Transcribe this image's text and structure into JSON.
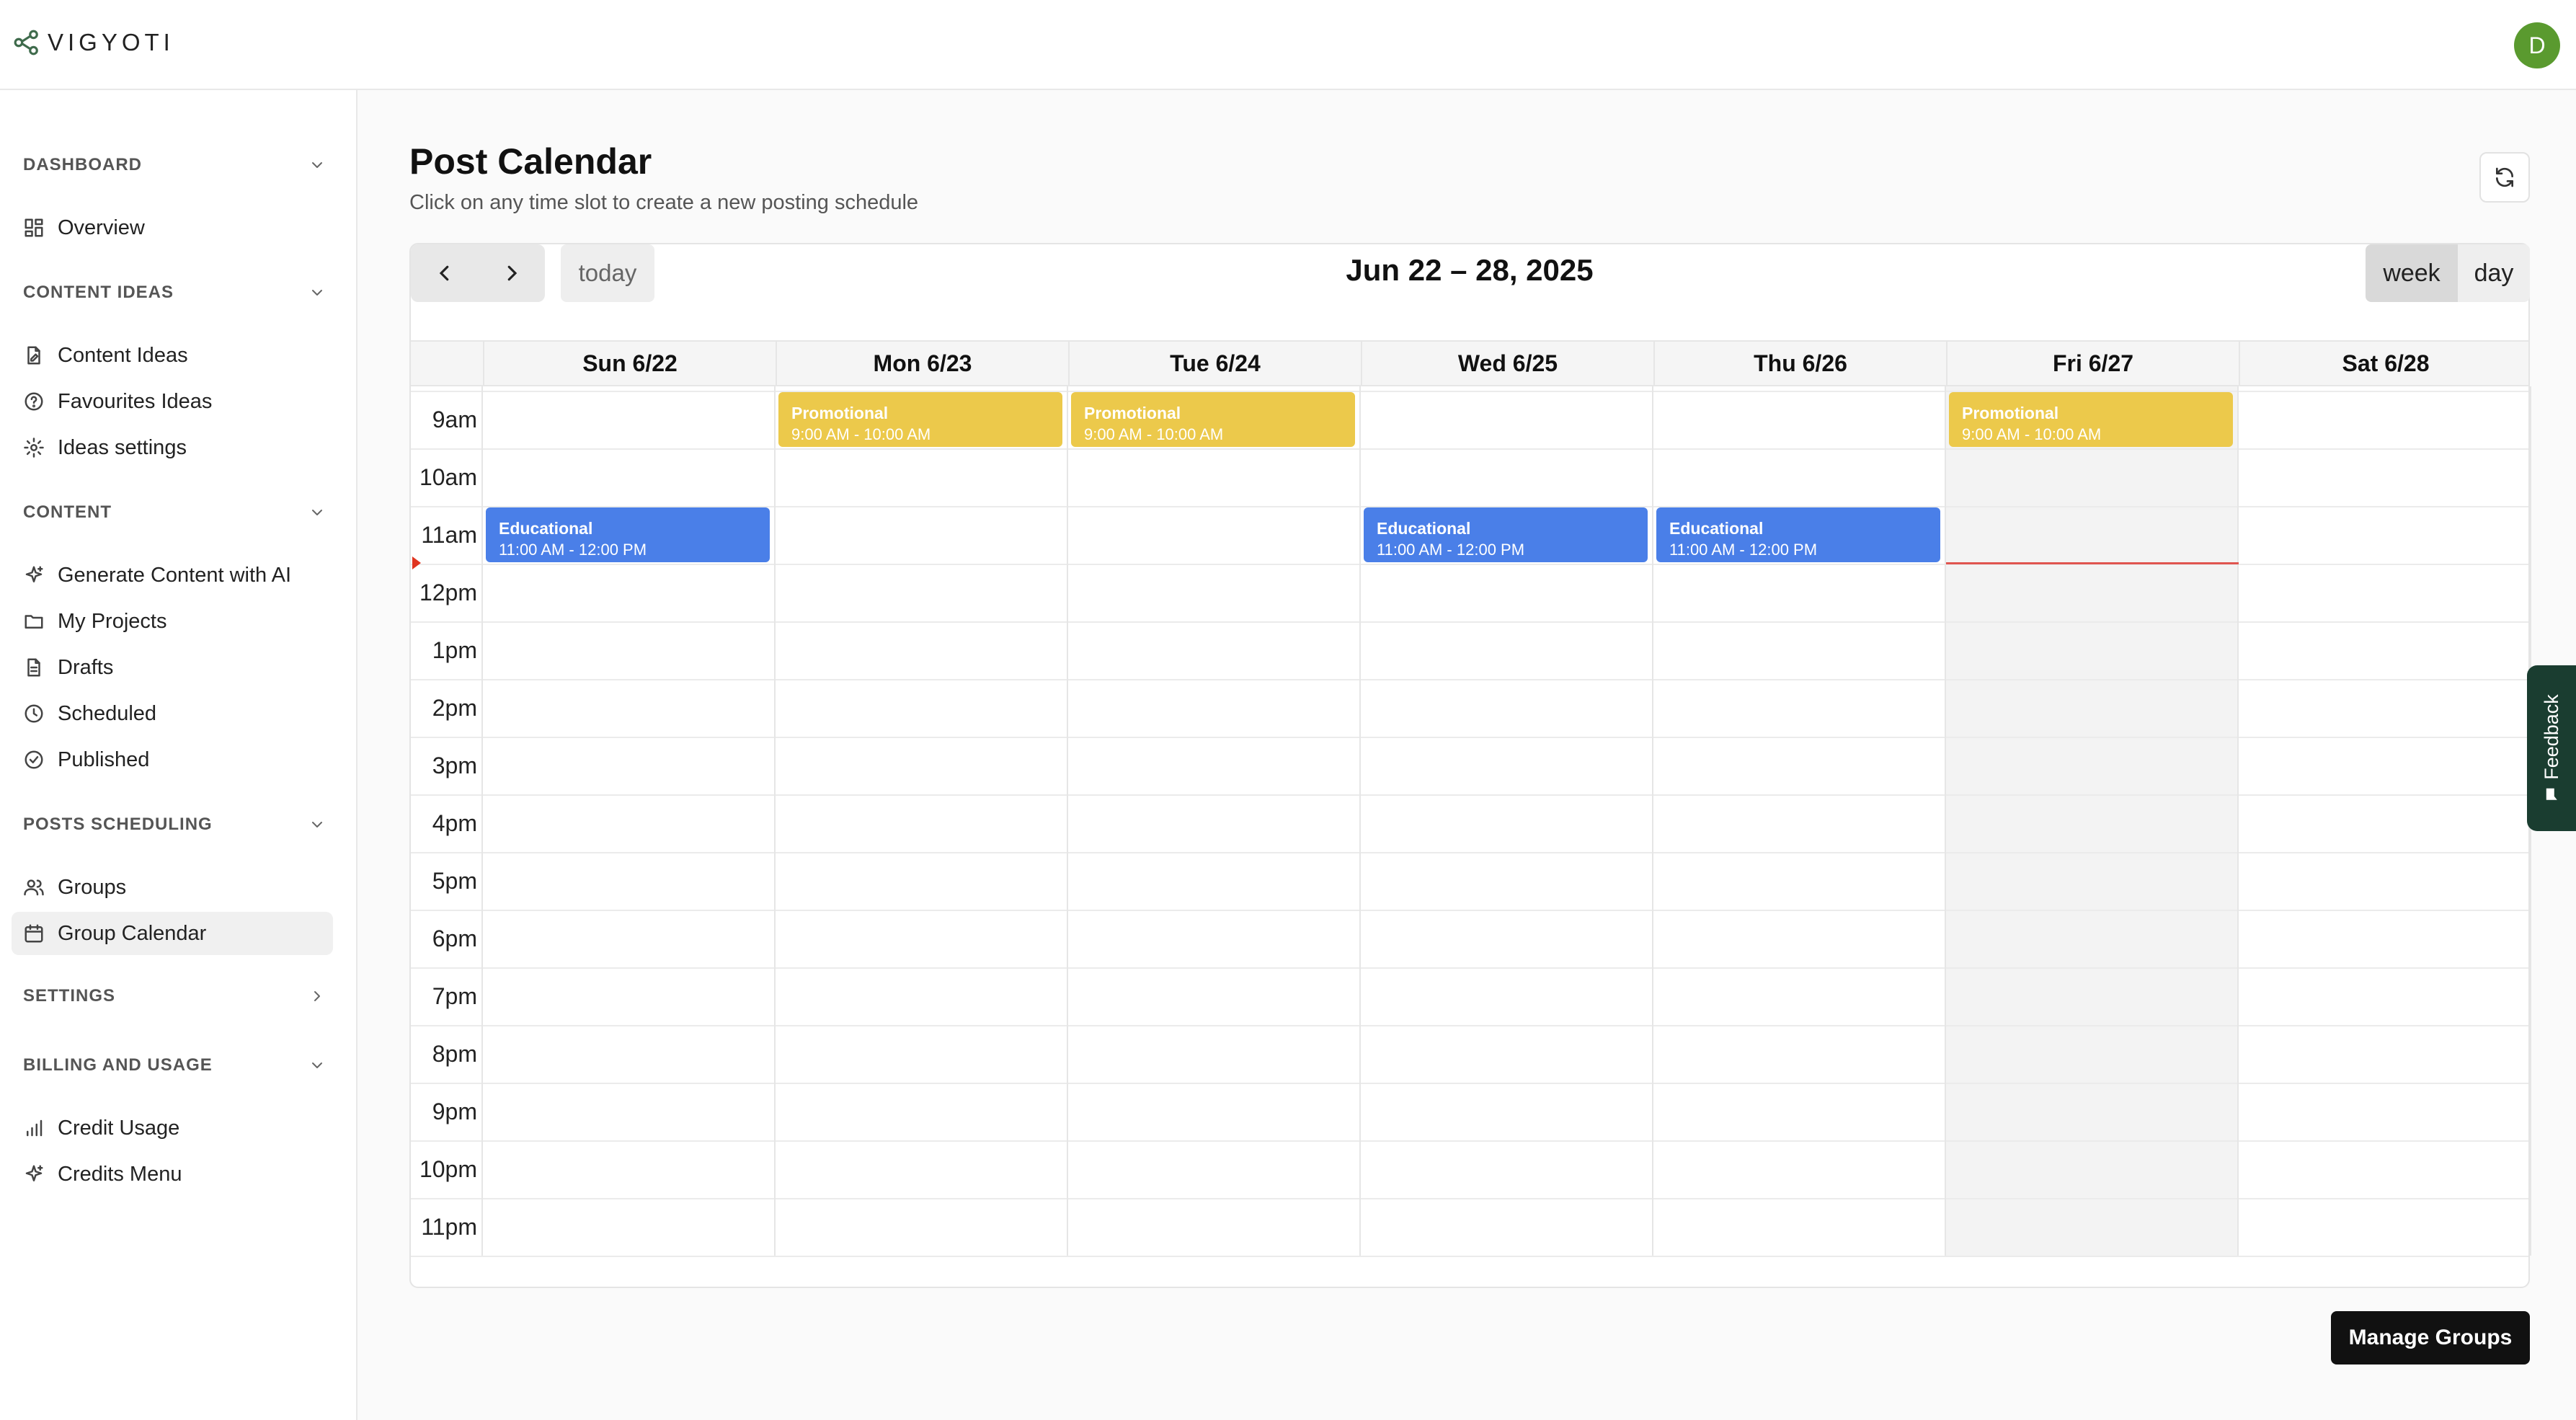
{
  "app": {
    "brand": "VIGYOTI",
    "avatar_initial": "D",
    "avatar_color": "#5a9a2f"
  },
  "sidebar": {
    "sections": [
      {
        "title": "DASHBOARD",
        "chevron": "chevron-down-icon",
        "items": [
          {
            "label": "Overview",
            "icon": "grid-icon"
          }
        ]
      },
      {
        "title": "CONTENT IDEAS",
        "chevron": "chevron-down-icon",
        "items": [
          {
            "label": "Content Ideas",
            "icon": "file-pen-icon"
          },
          {
            "label": "Favourites Ideas",
            "icon": "help-circle-icon"
          },
          {
            "label": "Ideas settings",
            "icon": "gear-icon"
          }
        ]
      },
      {
        "title": "CONTENT",
        "chevron": "chevron-down-icon",
        "items": [
          {
            "label": "Generate Content with AI",
            "icon": "sparkle-icon"
          },
          {
            "label": "My Projects",
            "icon": "folder-icon"
          },
          {
            "label": "Drafts",
            "icon": "document-icon"
          },
          {
            "label": "Scheduled",
            "icon": "clock-icon"
          },
          {
            "label": "Published",
            "icon": "check-circle-icon"
          }
        ]
      },
      {
        "title": "POSTS SCHEDULING",
        "chevron": "chevron-down-icon",
        "items": [
          {
            "label": "Groups",
            "icon": "users-icon"
          },
          {
            "label": "Group Calendar",
            "icon": "calendar-icon",
            "active": true
          }
        ]
      },
      {
        "title": "SETTINGS",
        "chevron": "chevron-right-icon",
        "items": []
      },
      {
        "title": "BILLING AND USAGE",
        "chevron": "chevron-down-icon",
        "items": [
          {
            "label": "Credit Usage",
            "icon": "bar-chart-icon"
          },
          {
            "label": "Credits Menu",
            "icon": "sparkle-icon"
          }
        ]
      }
    ]
  },
  "page": {
    "title": "Post Calendar",
    "subtitle": "Click on any time slot to create a new posting schedule"
  },
  "calendar": {
    "today_label": "today",
    "range_title": "Jun 22 – 28, 2025",
    "views": {
      "week": "week",
      "day": "day",
      "active": "week"
    },
    "days": [
      "Sun 6/22",
      "Mon 6/23",
      "Tue 6/24",
      "Wed 6/25",
      "Thu 6/26",
      "Fri 6/27",
      "Sat 6/28"
    ],
    "today_day": "Fri 6/27",
    "time_slots": [
      "9am",
      "10am",
      "11am",
      "12pm",
      "1pm",
      "2pm",
      "3pm",
      "4pm",
      "5pm",
      "6pm",
      "7pm",
      "8pm",
      "9pm",
      "10pm",
      "11pm"
    ],
    "events": [
      {
        "day": "Mon 6/23",
        "title": "Promotional",
        "time": "9:00 AM - 10:00 AM",
        "type": "promo",
        "start_slot": "9am"
      },
      {
        "day": "Tue 6/24",
        "title": "Promotional",
        "time": "9:00 AM - 10:00 AM",
        "type": "promo",
        "start_slot": "9am"
      },
      {
        "day": "Fri 6/27",
        "title": "Promotional",
        "time": "9:00 AM - 10:00 AM",
        "type": "promo",
        "start_slot": "9am"
      },
      {
        "day": "Sun 6/22",
        "title": "Educational",
        "time": "11:00 AM - 12:00 PM",
        "type": "edu",
        "start_slot": "11am"
      },
      {
        "day": "Wed 6/25",
        "title": "Educational",
        "time": "11:00 AM - 12:00 PM",
        "type": "edu",
        "start_slot": "11am"
      },
      {
        "day": "Thu 6/26",
        "title": "Educational",
        "time": "11:00 AM - 12:00 PM",
        "type": "edu",
        "start_slot": "11am"
      }
    ],
    "colors": {
      "promo": "#ecc94b",
      "edu": "#4a7fe8",
      "now_line": "#e0554f"
    }
  },
  "feedback": {
    "label": "Feedback",
    "icon": "chat-bubble-icon"
  },
  "actions": {
    "manage_groups": "Manage Groups"
  }
}
